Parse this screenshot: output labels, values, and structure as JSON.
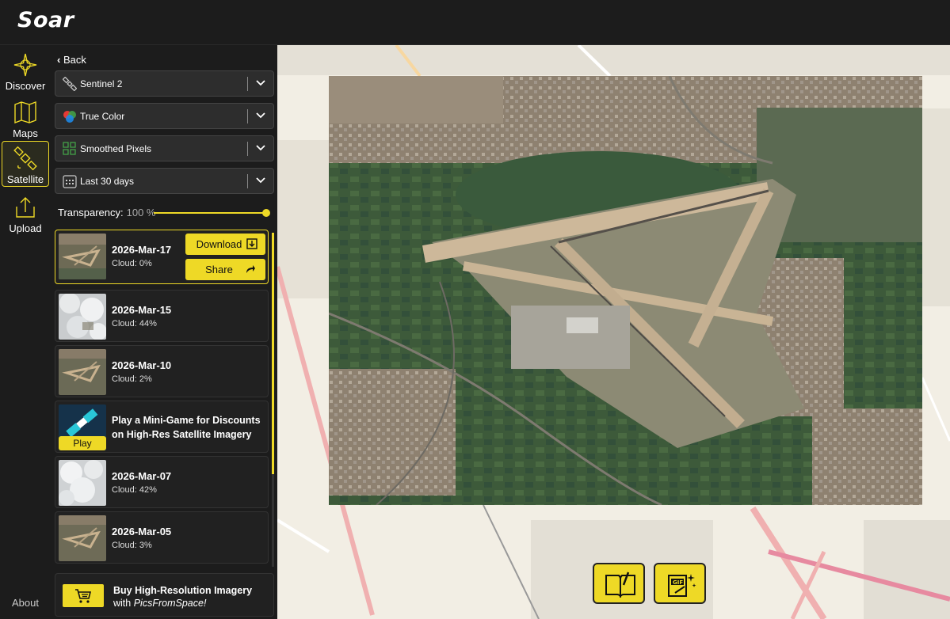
{
  "app": {
    "logo_text": "Soar",
    "accent_color": "#eed926"
  },
  "nav": {
    "items": [
      {
        "label": "Discover",
        "icon": "compass-star-icon"
      },
      {
        "label": "Maps",
        "icon": "folded-map-icon"
      },
      {
        "label": "Satellite",
        "icon": "satellite-icon",
        "active": true
      },
      {
        "label": "Upload",
        "icon": "upload-icon"
      }
    ],
    "about": "About"
  },
  "panel": {
    "back_label": "Back",
    "dropdowns": [
      {
        "label": "Sentinel 2",
        "icon": "satellite-icon"
      },
      {
        "label": "True Color",
        "icon": "color-circles-icon"
      },
      {
        "label": "Smoothed Pixels",
        "icon": "pixels-icon"
      },
      {
        "label": "Last 30 days",
        "icon": "calendar-icon"
      }
    ],
    "transparency": {
      "label": "Transparency:",
      "value": "100 %",
      "level": 1.0
    },
    "images": [
      {
        "date": "2026-Mar-17",
        "cloud": "Cloud: 0%",
        "selected": true,
        "download_label": "Download",
        "share_label": "Share"
      },
      {
        "date": "2026-Mar-15",
        "cloud": "Cloud: 44%"
      },
      {
        "date": "2026-Mar-10",
        "cloud": "Cloud: 2%"
      },
      {
        "date": "2026-Mar-07",
        "cloud": "Cloud: 42%"
      },
      {
        "date": "2026-Mar-05",
        "cloud": "Cloud: 3%"
      }
    ],
    "promo": {
      "text": "Play a Mini-Game for Discounts on High-Res Satellite Imagery",
      "play_label": "Play"
    },
    "buy": {
      "line1": "Buy High-Resolution Imagery",
      "line2_prefix": "with",
      "line2_brand": "PicsFromSpace!"
    }
  },
  "map": {
    "tools": [
      {
        "icon": "book-pencil-icon"
      },
      {
        "icon": "gif-sparkle-icon"
      }
    ]
  }
}
